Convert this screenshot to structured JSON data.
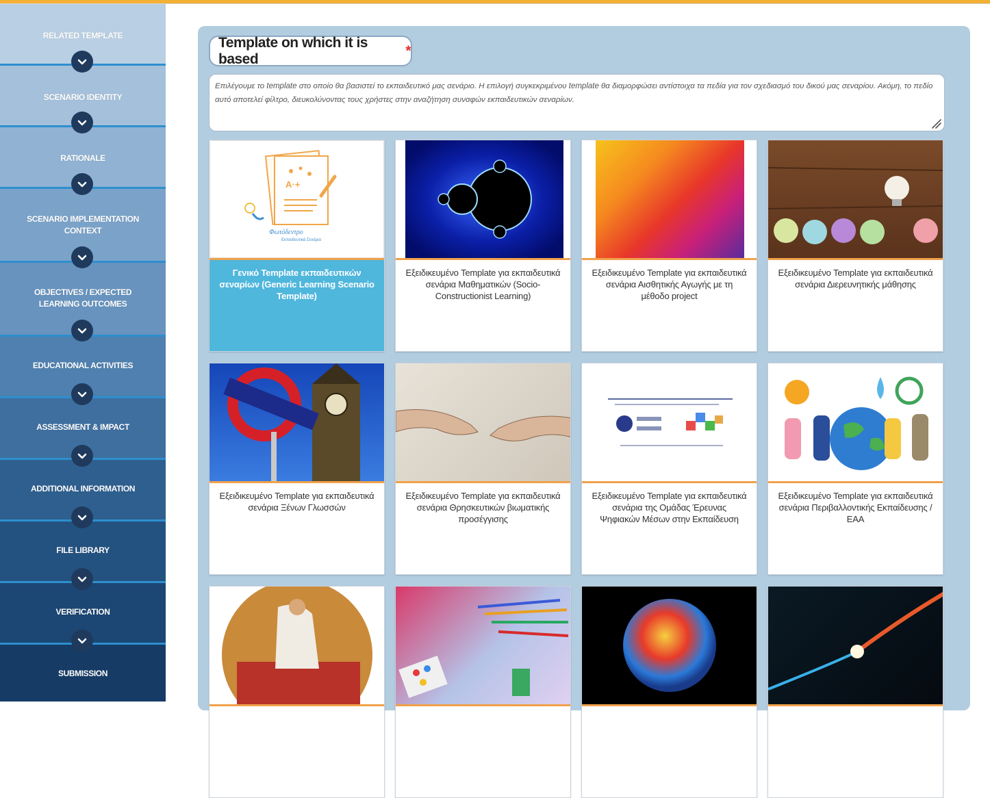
{
  "sidebar": {
    "items": [
      {
        "label": "RELATED TEMPLATE"
      },
      {
        "label": "SCENARIO IDENTITY"
      },
      {
        "label": "RATIONALE"
      },
      {
        "label": "SCENARIO IMPLEMENTATION CONTEXT"
      },
      {
        "label": "OBJECTIVES / EXPECTED LEARNING OUTCOMES"
      },
      {
        "label": "EDUCATIONAL ACTIVITIES"
      },
      {
        "label": "ASSESSMENT & IMPACT"
      },
      {
        "label": "ADDITIONAL INFORMATION"
      },
      {
        "label": "FILE LIBRARY"
      },
      {
        "label": "VERIFICATION"
      },
      {
        "label": "SUBMISSION"
      }
    ]
  },
  "main": {
    "title": "Template on which it is based",
    "required_mark": "*",
    "description": "Επιλέγουμε το template στο οποίο θα βασιστεί το εκπαιδευτικό μας σενάριο. Η επιλογή συγκεκριμένου template θα διαμορφώσει αντίστοιχα τα πεδία για τον σχεδιασμό του δικού μας σεναρίου. Ακόμη, το πεδίο αυτό αποτελεί φίλτρο, διευκολύνοντας τους χρήστες στην αναζήτηση συναφών εκπαιδευτικών σεναρίων.",
    "templates": [
      {
        "caption": "Γενικό Template εκπαιδευτικών σεναρίων (Generic Learning Scenario Template)",
        "selected": true,
        "image": "photodentro-logo"
      },
      {
        "caption": "Εξειδικευμένο Template για εκπαιδευτικά σενάρια Μαθηματικών (Socio-Constructionist Learning)",
        "selected": false,
        "image": "mandelbrot-fractal"
      },
      {
        "caption": "Εξειδικευμένο Template για εκπαιδευτικά σενάρια Αισθητικής Αγωγής με τη μέθοδο project",
        "selected": false,
        "image": "watercolor-paint"
      },
      {
        "caption": "Εξειδικευμένο Template για εκπαιδευτικά σενάρια Διερευνητικής μάθησης",
        "selected": false,
        "image": "paper-balls-lightbulb"
      },
      {
        "caption": "Εξειδικευμένο Template για εκπαιδευτικά σενάρια Ξένων Γλωσσών",
        "selected": false,
        "image": "big-ben-underground"
      },
      {
        "caption": "Εξειδικευμένο Template για εκπαιδευτικά σενάρια Θρησκευτικών βιωματικής προσέγγισης",
        "selected": false,
        "image": "creation-of-adam"
      },
      {
        "caption": "Εξειδικευμένο Template για εκπαιδευτικά σενάρια της Ομάδας Έρευνας Ψηφιακών Μέσων στην Εκπαίδευση",
        "selected": false,
        "image": "aegean-slide"
      },
      {
        "caption": "Εξειδικευμένο Template για εκπαιδευτικά σενάρια Περιβαλλοντικής Εκπαίδευσης / ΕΑΑ",
        "selected": false,
        "image": "earth-kids"
      },
      {
        "caption": "",
        "selected": false,
        "image": "classical-painting"
      },
      {
        "caption": "",
        "selected": false,
        "image": "art-supplies"
      },
      {
        "caption": "",
        "selected": false,
        "image": "colorful-sphere"
      },
      {
        "caption": "",
        "selected": false,
        "image": "light-streak"
      }
    ]
  },
  "colors": {
    "accent_bar": "#f0a14a",
    "selected_card": "#4fb6dc",
    "panel_bg": "#b3cde0",
    "required": "#e53030"
  }
}
